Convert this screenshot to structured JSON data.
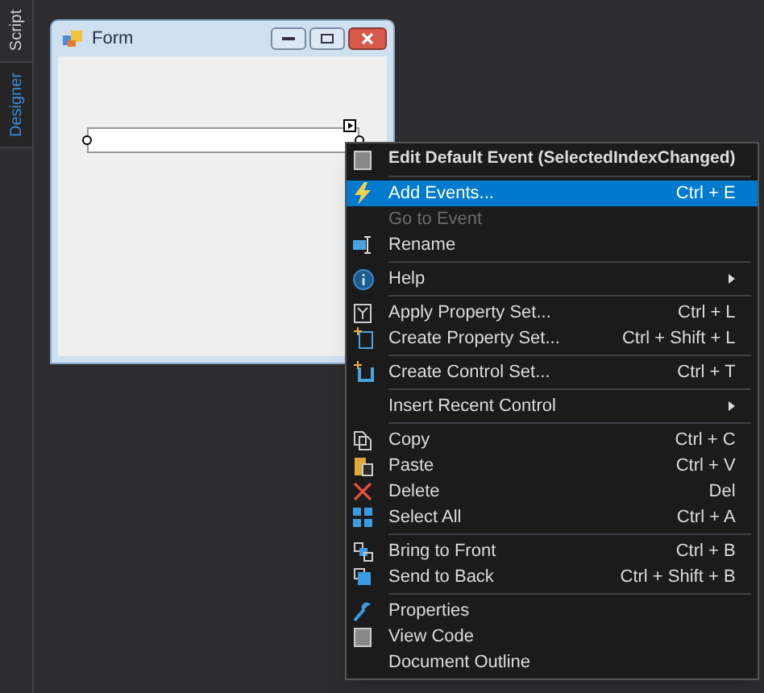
{
  "side_tabs": [
    {
      "label": "Script",
      "selected": false
    },
    {
      "label": "Designer",
      "selected": true
    }
  ],
  "form": {
    "title": "Form"
  },
  "context_menu": {
    "items": [
      {
        "kind": "item",
        "label": "Edit Default Event (SelectedIndexChanged)",
        "bold": true,
        "selected": false,
        "disabled": false
      },
      {
        "kind": "separator"
      },
      {
        "kind": "item",
        "label": "Add Events...",
        "shortcut": "Ctrl + E",
        "selected": true,
        "disabled": false
      },
      {
        "kind": "item",
        "label": "Go to Event",
        "selected": false,
        "disabled": true
      },
      {
        "kind": "item",
        "label": "Rename",
        "selected": false,
        "disabled": false
      },
      {
        "kind": "separator"
      },
      {
        "kind": "item",
        "label": "Help",
        "submenu": true,
        "selected": false,
        "disabled": false
      },
      {
        "kind": "separator"
      },
      {
        "kind": "item",
        "label": "Apply Property Set...",
        "shortcut": "Ctrl + L",
        "selected": false,
        "disabled": false
      },
      {
        "kind": "item",
        "label": "Create Property Set...",
        "shortcut": "Ctrl + Shift + L",
        "selected": false,
        "disabled": false
      },
      {
        "kind": "separator"
      },
      {
        "kind": "item",
        "label": "Create Control Set...",
        "shortcut": "Ctrl + T",
        "selected": false,
        "disabled": false
      },
      {
        "kind": "separator"
      },
      {
        "kind": "item",
        "label": "Insert Recent Control",
        "submenu": true,
        "selected": false,
        "disabled": false
      },
      {
        "kind": "separator"
      },
      {
        "kind": "item",
        "label": "Copy",
        "shortcut": "Ctrl + C",
        "selected": false,
        "disabled": false
      },
      {
        "kind": "item",
        "label": "Paste",
        "shortcut": "Ctrl + V",
        "selected": false,
        "disabled": false
      },
      {
        "kind": "item",
        "label": "Delete",
        "shortcut": "Del",
        "selected": false,
        "disabled": false
      },
      {
        "kind": "item",
        "label": "Select All",
        "shortcut": "Ctrl + A",
        "selected": false,
        "disabled": false
      },
      {
        "kind": "separator"
      },
      {
        "kind": "item",
        "label": "Bring to Front",
        "shortcut": "Ctrl + B",
        "selected": false,
        "disabled": false
      },
      {
        "kind": "item",
        "label": "Send to Back",
        "shortcut": "Ctrl + Shift + B",
        "selected": false,
        "disabled": false
      },
      {
        "kind": "separator"
      },
      {
        "kind": "item",
        "label": "Properties",
        "selected": false,
        "disabled": false
      },
      {
        "kind": "item",
        "label": "View Code",
        "selected": false,
        "disabled": false
      },
      {
        "kind": "item",
        "label": "Document Outline",
        "selected": false,
        "disabled": false
      }
    ]
  }
}
